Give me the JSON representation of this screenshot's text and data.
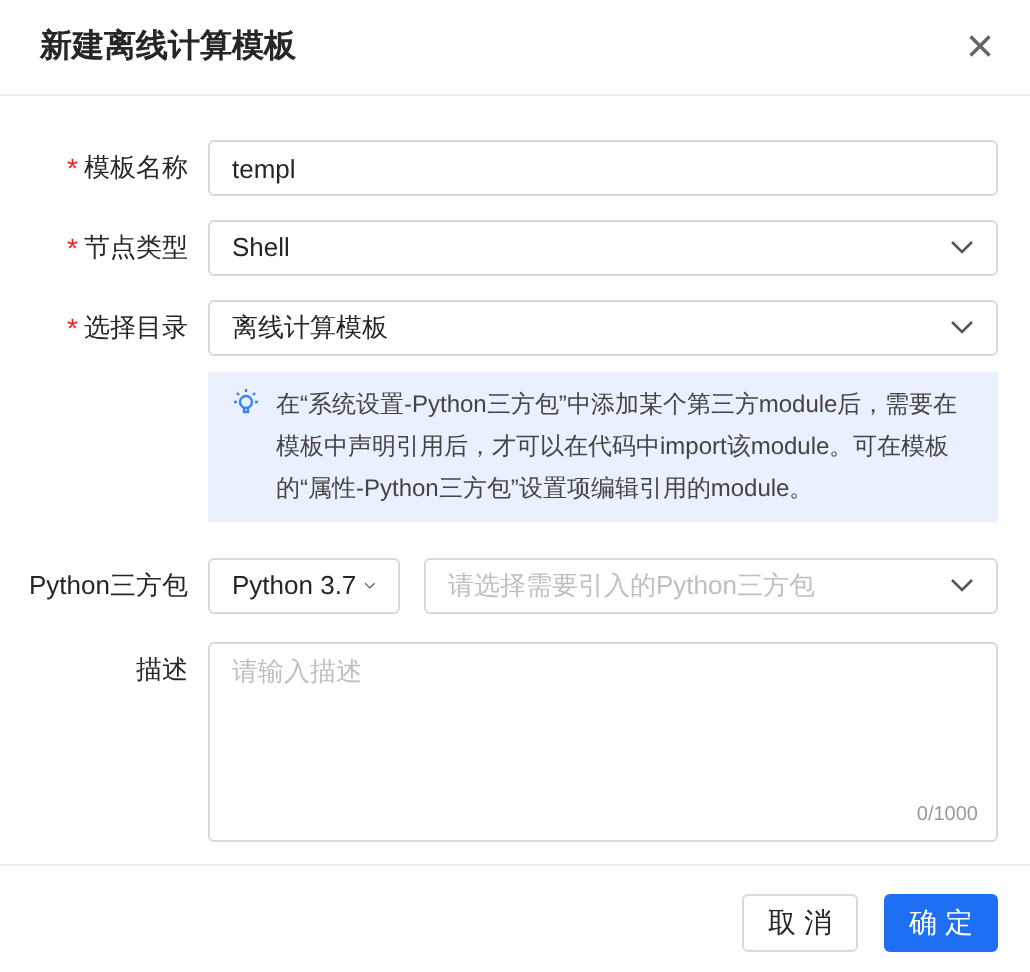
{
  "dialog": {
    "title": "新建离线计算模板",
    "close": "×"
  },
  "fields": [
    {
      "kind": "text",
      "label": "模板名称",
      "required_mark": "*",
      "value": "templ"
    },
    {
      "kind": "select",
      "label": "节点类型",
      "required_mark": "*",
      "value": "Shell"
    },
    {
      "kind": "select",
      "label": "选择目录",
      "required_mark": "*",
      "value": "离线计算模板"
    },
    {
      "kind": "notice",
      "text": "在“系统设置-Python三方包”中添加某个第三方module后，需要在模板中声明引用后，才可以在代码中import该module。可在模板的“属性-Python三方包”设置项编辑引用的module。"
    },
    {
      "kind": "python",
      "label": "Python三方包",
      "version": "Python 3.7",
      "placeholder": "请选择需要引入的Python三方包"
    },
    {
      "kind": "textarea",
      "label": "描述",
      "placeholder": "请输入描述",
      "counter": "0/1000"
    }
  ],
  "buttons": [
    {
      "label": "取 消",
      "kind": "default"
    },
    {
      "label": "确 定",
      "kind": "primary"
    }
  ]
}
